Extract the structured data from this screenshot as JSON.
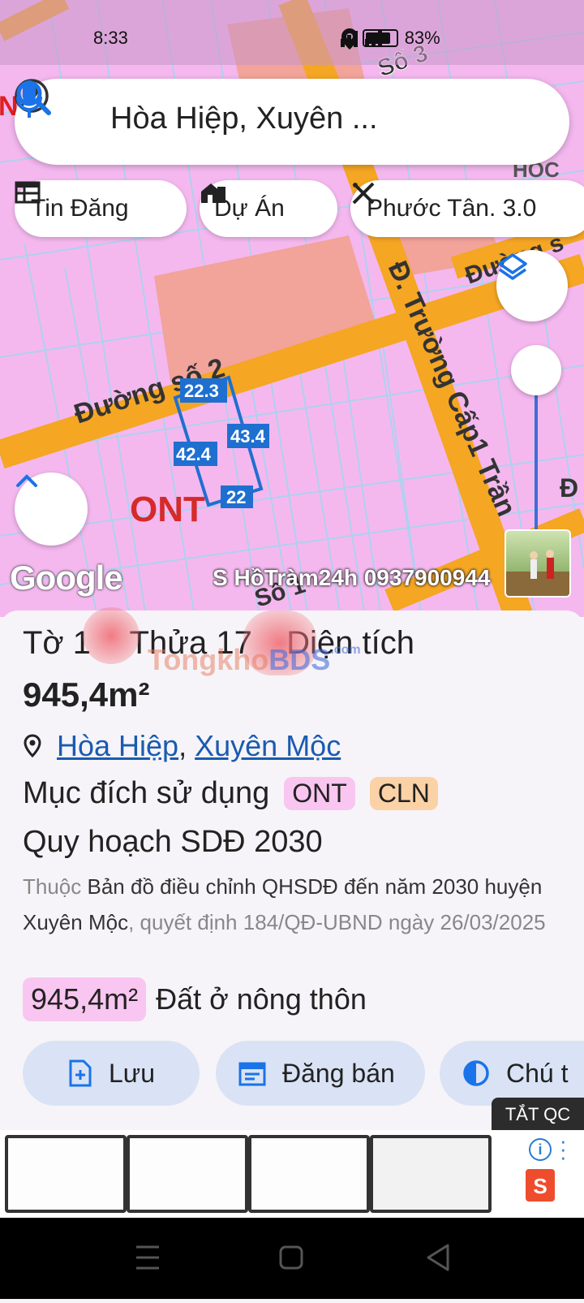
{
  "status_bar": {
    "time": "8:33",
    "network": "4G",
    "battery": "83%"
  },
  "search": {
    "query": "Hòa Hiệp, Xuyên ..."
  },
  "chips": [
    {
      "label": "Tin Đăng",
      "icon": "table-icon"
    },
    {
      "label": "Dự Án",
      "icon": "building-icon"
    },
    {
      "label": "Phước Tân. 3.0",
      "icon": "ruler-pencil-icon"
    }
  ],
  "map": {
    "roads": [
      "Số 3",
      "Đường số 2",
      "Đ. Trường Cấp1 Trần",
      "Đường s",
      "Số 1"
    ],
    "partial_labels": {
      "top_left": "N",
      "top_right": "HOC",
      "right_edge": "Đ"
    },
    "zone_label": "ONT",
    "measurements": [
      "22.3",
      "43.4",
      "42.4",
      "22"
    ],
    "attribution": "Google",
    "watermark": "S HồTràm24h 0937900944"
  },
  "sheet": {
    "title_parts": [
      "Tờ 1",
      "Thửa 17",
      "Diện tích"
    ],
    "brand_watermark": {
      "left": "Tongkho",
      "right": "BDS",
      "suffix": ".com"
    },
    "area": "945,4m²",
    "location": {
      "ward": "Hòa Hiệp",
      "separator": ",",
      "district": "Xuyên Mộc"
    },
    "purpose_label": "Mục đích sử dụng",
    "purposes": [
      {
        "code": "ONT",
        "color": "#f8c6f0"
      },
      {
        "code": "CLN",
        "color": "#fbd2a6"
      }
    ],
    "plan_title": "Quy hoạch SDĐ 2030",
    "plan_desc": {
      "prefix": "Thuộc",
      "map_name": "Bản đồ điều chỉnh QHSDĐ đến năm 2030 huyện Xuyên Mộc",
      "decision": ", quyết định 184/QĐ-UBND ngày 26/03/2025"
    },
    "zone_area": {
      "area": "945,4m²",
      "type": "Đất ở nông thôn"
    }
  },
  "actions": [
    {
      "label": "Lưu",
      "icon": "save-add-icon"
    },
    {
      "label": "Đăng bán",
      "icon": "calendar-icon"
    },
    {
      "label": "Chú t",
      "icon": "contrast-icon"
    }
  ],
  "ad": {
    "close_label": "TẮT QC",
    "store_icon": "S"
  }
}
